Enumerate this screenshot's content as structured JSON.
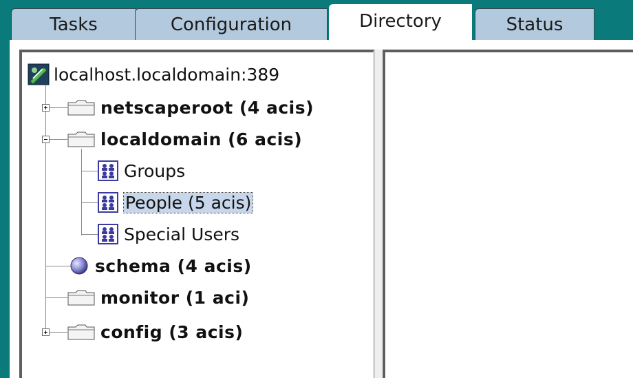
{
  "tabs": [
    {
      "label": "Tasks",
      "active": false
    },
    {
      "label": "Configuration",
      "active": false
    },
    {
      "label": "Directory",
      "active": true
    },
    {
      "label": "Status",
      "active": false
    }
  ],
  "tree": {
    "root": {
      "label": "localhost.localdomain:389",
      "icon": "server-icon"
    },
    "items": [
      {
        "label": "netscaperoot  (4 acis)",
        "icon": "folder-icon",
        "expander": "plus"
      },
      {
        "label": "localdomain  (6 acis)",
        "icon": "folder-icon",
        "expander": "minus",
        "children": [
          {
            "label": "Groups",
            "icon": "group-icon"
          },
          {
            "label": "People  (5 acis)",
            "icon": "group-icon",
            "selected": true
          },
          {
            "label": "Special Users",
            "icon": "group-icon"
          }
        ]
      },
      {
        "label": "schema  (4 acis)",
        "icon": "globe-icon"
      },
      {
        "label": "monitor  (1 aci)",
        "icon": "folder-icon"
      },
      {
        "label": "config  (3 acis)",
        "icon": "folder-icon",
        "expander": "plus"
      }
    ]
  },
  "colors": {
    "background": "#0b7a7a",
    "tab": "#b3c9dd",
    "selection": "#c7d6ea"
  }
}
